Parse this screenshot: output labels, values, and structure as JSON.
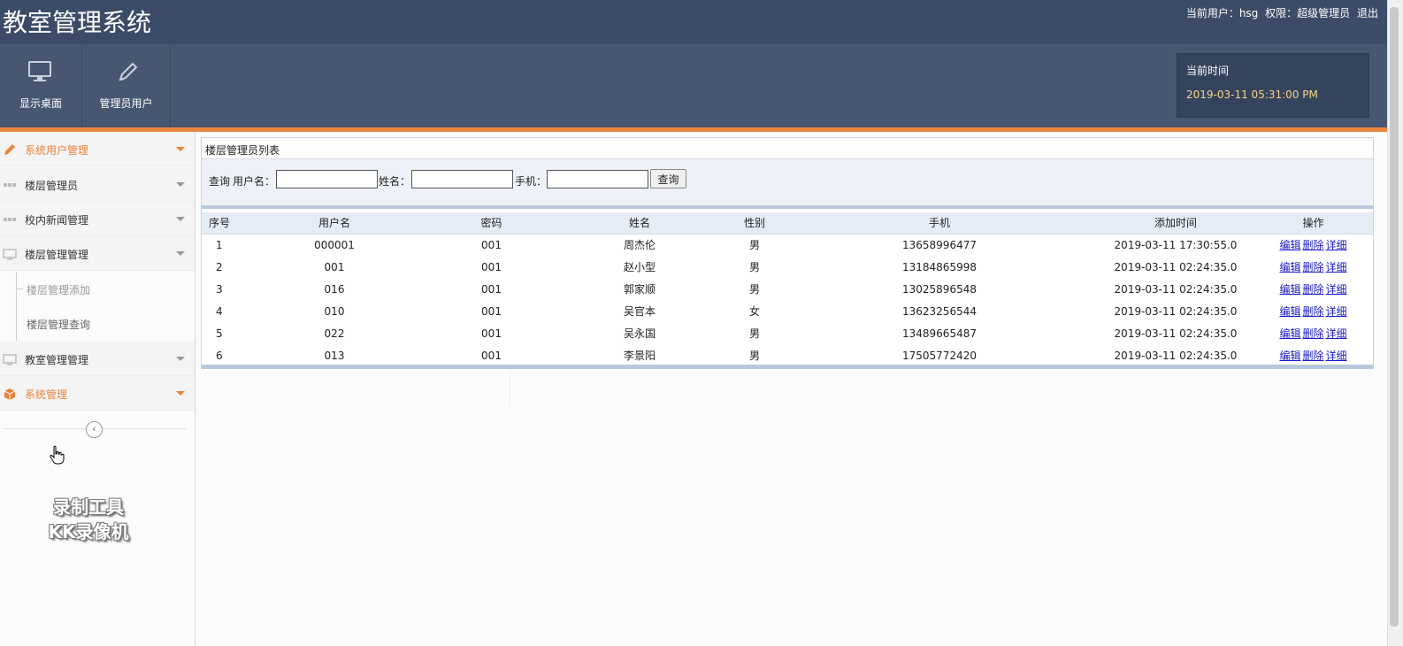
{
  "app": {
    "title": "教室管理系统"
  },
  "header": {
    "user_prefix": "当前用户：hsg",
    "role_prefix": "权限：超级管理员",
    "logout": "退出"
  },
  "toolbar": {
    "desktop_label": "显示桌面",
    "admin_label": "管理员用户",
    "time_label": "当前时间",
    "time_value": "2019-03-11 05:31:00 PM"
  },
  "sidebar": {
    "menus": [
      {
        "label": "系统用户管理",
        "icon": "pencil-icon"
      },
      {
        "label": "楼层管理员",
        "icon": "grid-icon"
      },
      {
        "label": "校内新闻管理",
        "icon": "grid-icon"
      },
      {
        "label": "楼层管理管理",
        "icon": "monitor-icon"
      },
      {
        "label": "教室管理管理",
        "icon": "monitor-icon"
      },
      {
        "label": "系统管理",
        "icon": "box-icon"
      }
    ],
    "submenus": [
      {
        "label": "楼层管理添加"
      },
      {
        "label": "楼层管理查询"
      }
    ],
    "collapse_glyph": "‹"
  },
  "watermark": {
    "line1": "录制工具",
    "line2": "KK录像机"
  },
  "panel": {
    "title": "楼层管理员列表"
  },
  "search": {
    "query_label": "查询",
    "username_label": "用户名：",
    "name_label": "姓名：",
    "phone_label": "手机：",
    "button": "查询"
  },
  "table": {
    "columns": [
      "序号",
      "用户名",
      "密码",
      "姓名",
      "性别",
      "手机",
      "添加时间",
      "操作"
    ],
    "actions": {
      "edit": "编辑",
      "delete": "删除",
      "detail": "详细"
    },
    "rows": [
      {
        "no": "1",
        "username": "000001",
        "password": "001",
        "name": "周杰伦",
        "gender": "男",
        "phone": "13658996477",
        "added": "2019-03-11 17:30:55.0"
      },
      {
        "no": "2",
        "username": "001",
        "password": "001",
        "name": "赵小型",
        "gender": "男",
        "phone": "13184865998",
        "added": "2019-03-11 02:24:35.0"
      },
      {
        "no": "3",
        "username": "016",
        "password": "001",
        "name": "郭家顺",
        "gender": "男",
        "phone": "13025896548",
        "added": "2019-03-11 02:24:35.0"
      },
      {
        "no": "4",
        "username": "010",
        "password": "001",
        "name": "吴官本",
        "gender": "女",
        "phone": "13623256544",
        "added": "2019-03-11 02:24:35.0"
      },
      {
        "no": "5",
        "username": "022",
        "password": "001",
        "name": "吴永国",
        "gender": "男",
        "phone": "13489665487",
        "added": "2019-03-11 02:24:35.0"
      },
      {
        "no": "6",
        "username": "013",
        "password": "001",
        "name": "李景阳",
        "gender": "男",
        "phone": "17505772420",
        "added": "2019-03-11 02:24:35.0"
      }
    ]
  },
  "colors": {
    "header_bg": "#3c4c68",
    "toolbar_bg": "#475771",
    "accent_orange": "#e9853f",
    "time_text": "#f3d48a",
    "link": "#1a1ac8"
  }
}
